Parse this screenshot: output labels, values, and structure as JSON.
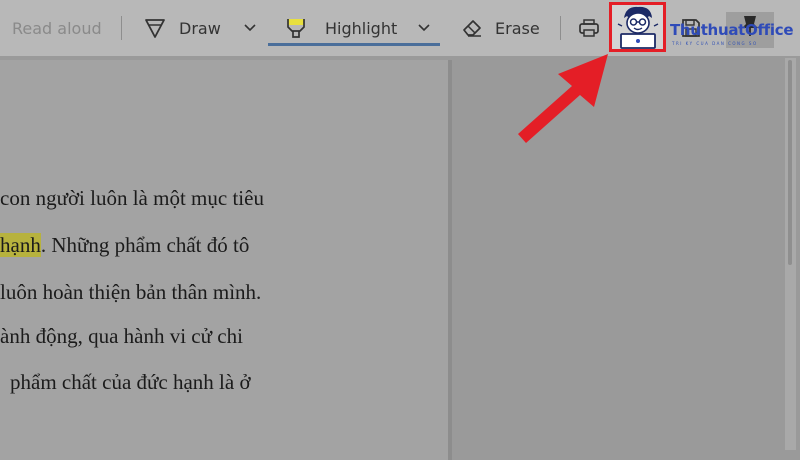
{
  "toolbar": {
    "read_aloud_label": "Read aloud",
    "draw_label": "Draw",
    "highlight_label": "Highlight",
    "erase_label": "Erase"
  },
  "document": {
    "lines": [
      {
        "text": "con người luôn là một mục tiêu"
      },
      {
        "highlighted": "hạnh",
        "text": ". Những phẩm chất đó tô"
      },
      {
        "text": "luôn hoàn thiện bản thân mình."
      },
      {
        "text": "ành động, qua hành vi cử chi"
      },
      {
        "text": "phẩm chất của đức hạnh là ở"
      }
    ]
  },
  "watermark": {
    "brand": "ThuthuatOffice",
    "tagline": "TRI KY CUA DAN CONG SO"
  },
  "colors": {
    "highlight": "#b7b23e",
    "annotation_red": "#e41e26",
    "brand_blue": "#2f4bb8"
  }
}
